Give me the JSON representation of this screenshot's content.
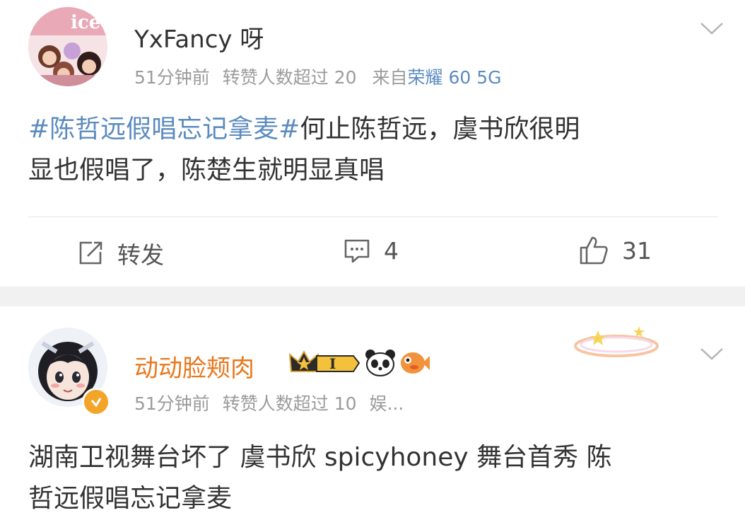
{
  "post1": {
    "username": "YxFancy 呀",
    "meta_time": "51分钟前",
    "meta_reposts": "转赞人数超过 20",
    "meta_from": "来自",
    "meta_device": "荣耀 60 5G",
    "topic": "#陈哲远假唱忘记拿麦#",
    "body_line1": "何止陈哲远，虞书欣很明",
    "body_line2": "显也假唱了，陈楚生就明显真唱",
    "actions": {
      "repost_label": "转发",
      "comment_count": "4",
      "like_count": "31"
    }
  },
  "post2": {
    "username": "动动脸颊肉",
    "meta_time": "51分钟前",
    "meta_reposts": "转赞人数超过 10",
    "meta_tag": "娱...",
    "body_line1": "湖南卫视舞台坏了 虞书欣 spicyhoney 舞台首秀 陈",
    "body_line2": "哲远假唱忘记拿麦",
    "level_badge": "I"
  },
  "colors": {
    "link_blue": "#5b8bbf",
    "vip_orange": "#e8781d",
    "meta_gray": "#9b9b9b",
    "divider_gray": "#f1f1f1"
  },
  "icons": [
    "chevron-down-icon",
    "repost-icon",
    "comment-icon",
    "like-icon",
    "verified-badge-icon",
    "crown-icon",
    "panda-icon",
    "fish-icon"
  ]
}
